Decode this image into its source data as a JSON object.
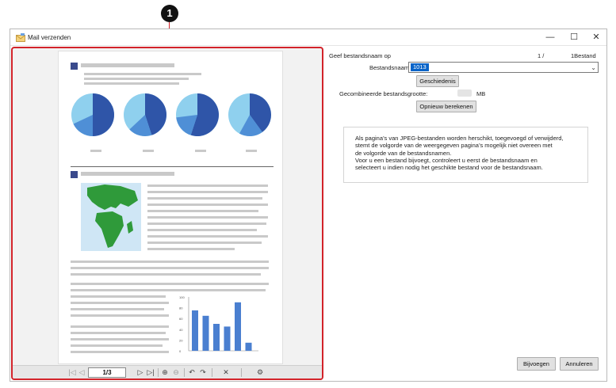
{
  "callout": {
    "number": "1"
  },
  "window": {
    "title": "Mail verzenden",
    "controls": {
      "minimize": "—",
      "maximize": "☐",
      "close": "✕"
    }
  },
  "preview": {
    "toolbar": {
      "first": "|◁",
      "prev": "◁",
      "page_indicator": "1/3",
      "next": "▷",
      "last": "▷|",
      "zoom_in": "⊕",
      "zoom_out": "⊖",
      "rotate_left": "↶",
      "rotate_right": "↷",
      "delete": "✕",
      "settings": "⚙"
    },
    "charts": {
      "pies": [
        {
          "share": 0.5,
          "dark": "#2f55a8",
          "mid": "#4f8fd6",
          "light": "#8fd0ee"
        },
        {
          "share": 0.45,
          "dark": "#2f55a8",
          "mid": "#4f8fd6",
          "light": "#8fd0ee"
        },
        {
          "share": 0.55,
          "dark": "#2f55a8",
          "mid": "#4f8fd6",
          "light": "#8fd0ee"
        },
        {
          "share": 0.4,
          "dark": "#2f55a8",
          "mid": "#4f8fd6",
          "light": "#8fd0ee"
        }
      ],
      "bar_axis_ticks": [
        "100",
        "80",
        "60",
        "40",
        "20",
        "0"
      ],
      "bar_values": [
        75,
        65,
        50,
        45,
        90,
        15
      ],
      "bar_color": "#4a7fd0"
    }
  },
  "form": {
    "geef_label": "Geef bestandsnaam op",
    "counter_current": "1 /",
    "counter_total": "1Bestand",
    "bestandsnaam_label": "Bestandsnaam:",
    "bestandsnaam_value": "1013",
    "geschiedenis_button": "Geschiedenis",
    "grootte_label": "Gecombineerde bestandsgrootte:",
    "grootte_unit": "MB",
    "herbereken_button": "Opnieuw berekenen",
    "info_lines": [
      "Als pagina’s van JPEG-bestanden worden herschikt, toegevoegd of verwijderd,",
      "stemt de volgorde van de weergegeven pagina’s mogelijk niet overeen met",
      "de volgorde van de bestandsnamen.",
      "Voor u een bestand bijvoegt, controleert u eerst de bestandsnaam en",
      "selecteert u indien nodig het geschikte bestand voor de bestandsnaam."
    ],
    "bijvoegen_button": "Bijvoegen",
    "annuleren_button": "Annuleren"
  }
}
